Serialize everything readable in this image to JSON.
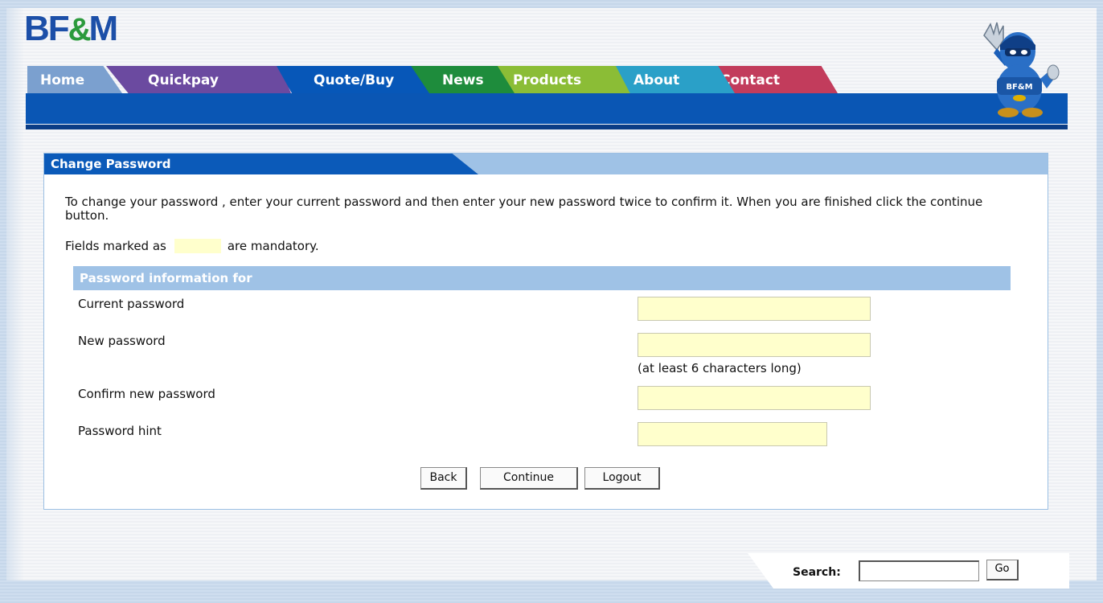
{
  "brand": {
    "logo_prefix": "BF",
    "logo_amp": "&",
    "logo_suffix": "M",
    "mascot_badge": "BF&M"
  },
  "nav": {
    "tabs": [
      {
        "label": "Home",
        "color": "#7ba0cf"
      },
      {
        "label": "Quickpay",
        "color": "#6b4aa0"
      },
      {
        "label": "Quote/Buy",
        "color": "#0757b8",
        "active": true
      },
      {
        "label": "News",
        "color": "#1e8c3c"
      },
      {
        "label": "Products",
        "color": "#8bbd36"
      },
      {
        "label": "About",
        "color": "#2aa0c8"
      },
      {
        "label": "Contact",
        "color": "#c23c5c"
      }
    ]
  },
  "panel": {
    "title": "Change Password",
    "intro": "To change your password , enter your current password and then enter your new password twice to confirm it. When you are finished click the continue button.",
    "mandatory_prefix": "Fields marked as",
    "mandatory_suffix": "are mandatory.",
    "mandatory_color": "#ffffcc",
    "section_title": "Password information for",
    "fields": {
      "current_label": "Current password",
      "current_value": "",
      "new_label": "New password",
      "new_value": "",
      "new_hint": "(at least 6 characters long)",
      "confirm_label": "Confirm new password",
      "confirm_value": "",
      "hint_label": "Password hint",
      "hint_value": ""
    },
    "buttons": {
      "back": "Back",
      "continue": "Continue",
      "logout": "Logout"
    }
  },
  "search": {
    "label": "Search:",
    "value": "",
    "go": "Go"
  }
}
